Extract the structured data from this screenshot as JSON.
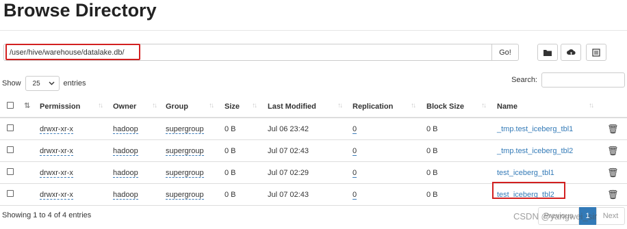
{
  "page_title": "Browse Directory",
  "path": {
    "value": "/user/hive/warehouse/datalake.db/",
    "go_label": "Go!"
  },
  "toolbar": {
    "folder_icon": "folder-icon",
    "upload_icon": "cloud-upload-icon",
    "list_icon": "list-icon"
  },
  "length": {
    "show_label": "Show",
    "selected": "25",
    "entries_label": "entries"
  },
  "search": {
    "label": "Search:",
    "value": ""
  },
  "table": {
    "headers": [
      "Permission",
      "Owner",
      "Group",
      "Size",
      "Last Modified",
      "Replication",
      "Block Size",
      "Name"
    ],
    "rows": [
      {
        "permission": "drwxr-xr-x",
        "owner": "hadoop",
        "group": "supergroup",
        "size": "0 B",
        "modified": "Jul 06 23:42",
        "replication": "0",
        "block": "0 B",
        "name": "_tmp.test_iceberg_tbl1"
      },
      {
        "permission": "drwxr-xr-x",
        "owner": "hadoop",
        "group": "supergroup",
        "size": "0 B",
        "modified": "Jul 07 02:43",
        "replication": "0",
        "block": "0 B",
        "name": "_tmp.test_iceberg_tbl2"
      },
      {
        "permission": "drwxr-xr-x",
        "owner": "hadoop",
        "group": "supergroup",
        "size": "0 B",
        "modified": "Jul 07 02:29",
        "replication": "0",
        "block": "0 B",
        "name": "test_iceberg_tbl1"
      },
      {
        "permission": "drwxr-xr-x",
        "owner": "hadoop",
        "group": "supergroup",
        "size": "0 B",
        "modified": "Jul 07 02:43",
        "replication": "0",
        "block": "0 B",
        "name": "test_iceberg_tbl2"
      }
    ]
  },
  "footer": {
    "info": "Showing 1 to 4 of 4 entries",
    "previous": "Previous",
    "page": "1",
    "next": "Next"
  },
  "watermark": "CSDN @yangwei_sir",
  "colors": {
    "link": "#337ab7",
    "highlight": "#d21f1f",
    "active_page": "#337ab7"
  }
}
